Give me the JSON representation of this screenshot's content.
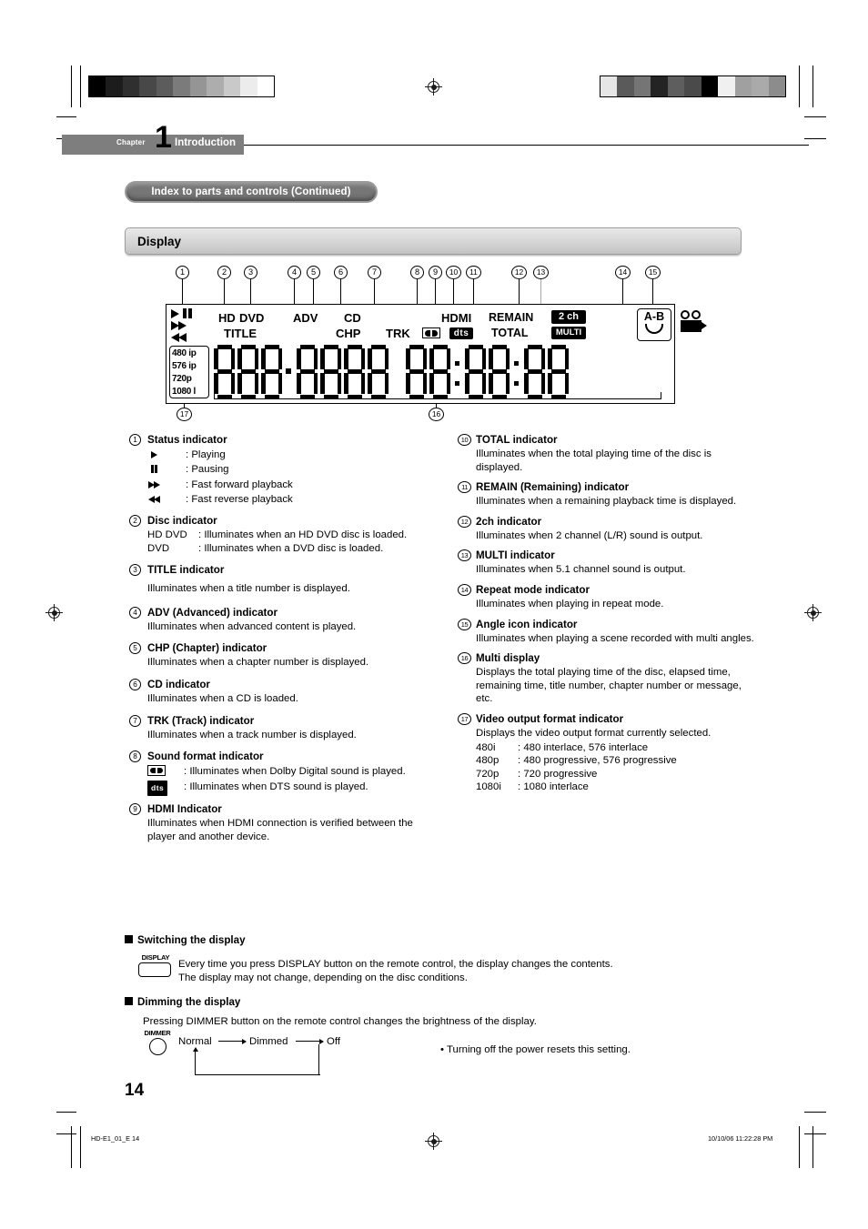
{
  "page": {
    "number": "14",
    "chapter_word": "Chapter",
    "chapter_number": "1",
    "chapter_name": "Introduction",
    "pill_title": "Index to parts and controls (Continued)",
    "section_title": "Display"
  },
  "footer": {
    "file": "HD-E1_01_E   14",
    "timestamp": "10/10/06   11:22:28 PM"
  },
  "calbars": {
    "left": [
      "#000000",
      "#1c1c1c",
      "#2f2f2f",
      "#484848",
      "#5c5c5c",
      "#7b7b7b",
      "#959595",
      "#adadad",
      "#c9c9c9",
      "#ececec",
      "#ffffff"
    ],
    "right": [
      "#e6e6e6",
      "#5a5a5a",
      "#757575",
      "#242424",
      "#5e5e5e",
      "#4a4a4a",
      "#000000",
      "#f0f0f0",
      "#a0a0a0",
      "#aaaaaa",
      "#8c8c8c"
    ]
  },
  "lcd": {
    "callouts": [
      "1",
      "2",
      "3",
      "4",
      "5",
      "6",
      "7",
      "8",
      "9",
      "10",
      "11",
      "12",
      "13",
      "14",
      "15",
      "16",
      "17"
    ],
    "labels": {
      "hd": "HD",
      "dvd": "DVD",
      "title": "TITLE",
      "adv": "ADV",
      "cd": "CD",
      "chp": "CHP",
      "trk": "TRK",
      "hdmi": "HDMI",
      "dts": "dts",
      "remain": "REMAIN",
      "total": "TOTAL",
      "two_ch": "2 ch",
      "multi": "MULTI",
      "ab": "A-B"
    },
    "video_formats": [
      "480 ip",
      "576 ip",
      "720p",
      "1080 l"
    ]
  },
  "items_left": [
    {
      "num": "1",
      "head": "Status indicator",
      "defs": [
        {
          "glyph": "play-icon",
          "text": ": Playing"
        },
        {
          "glyph": "pause-icon",
          "text": ": Pausing"
        },
        {
          "glyph": "fast-forward-icon",
          "text": ": Fast forward playback"
        },
        {
          "glyph": "fast-reverse-icon",
          "text": ": Fast reverse playback"
        }
      ]
    },
    {
      "num": "2",
      "head": "Disc indicator",
      "rows": [
        {
          "k": "HD DVD",
          "v": ": Illuminates when an HD DVD disc is loaded."
        },
        {
          "k": "DVD",
          "v": ": Illuminates when a DVD disc is loaded."
        }
      ]
    },
    {
      "num": "3",
      "head": "TITLE indicator",
      "body": "Illuminates when a title number is displayed."
    },
    {
      "num": "4",
      "head": "ADV (Advanced) indicator",
      "body": "Illuminates when advanced content is played."
    },
    {
      "num": "5",
      "head": "CHP (Chapter) indicator",
      "body": "Illuminates when a chapter number is displayed."
    },
    {
      "num": "6",
      "head": "CD indicator",
      "body": "Illuminates when a CD is loaded."
    },
    {
      "num": "7",
      "head": "TRK (Track) indicator",
      "body": "Illuminates when a track number is displayed."
    },
    {
      "num": "8",
      "head": "Sound format indicator",
      "sound_defs": [
        {
          "glyph": "dolby-digital-icon",
          "text": ": Illuminates when Dolby Digital sound is played."
        },
        {
          "glyph": "dts-icon",
          "text": ": Illuminates when DTS sound is played."
        }
      ]
    },
    {
      "num": "9",
      "head": "HDMI Indicator",
      "body": "Illuminates when HDMI connection is verified between the player and another device."
    }
  ],
  "items_right": [
    {
      "num": "10",
      "head": "TOTAL indicator",
      "body": "Illuminates when the total playing time of the disc is displayed."
    },
    {
      "num": "11",
      "head": "REMAIN (Remaining) indicator",
      "body": "Illuminates when a remaining playback time is displayed."
    },
    {
      "num": "12",
      "head": "2ch indicator",
      "body": "Illuminates when 2 channel (L/R) sound is output."
    },
    {
      "num": "13",
      "head": "MULTI indicator",
      "body": "Illuminates when 5.1 channel sound is output."
    },
    {
      "num": "14",
      "head": "Repeat mode indicator",
      "body": "Illuminates when playing in repeat mode."
    },
    {
      "num": "15",
      "head": "Angle icon indicator",
      "body": "Illuminates when playing a scene recorded with multi angles."
    },
    {
      "num": "16",
      "head": "Multi display",
      "body": "Displays the total playing time of the disc, elapsed time, remaining time, title number, chapter number or message, etc."
    },
    {
      "num": "17",
      "head": "Video output format indicator",
      "body": "Displays the video output format currently selected.",
      "formats": [
        {
          "k": "480i",
          "v": ":  480 interlace, 576 interlace"
        },
        {
          "k": "480p",
          "v": ":  480 progressive, 576 progressive"
        },
        {
          "k": "720p",
          "v": ":  720 progressive"
        },
        {
          "k": "1080i",
          "v": ":  1080 interlace"
        }
      ]
    }
  ],
  "switching": {
    "heading": "Switching the display",
    "button_label": "DISPLAY",
    "line1": "Every time you press DISPLAY button on the remote control, the display changes the contents.",
    "line2": "The display may not change, depending on the disc conditions."
  },
  "dimming": {
    "heading": "Dimming the display",
    "intro": "Pressing DIMMER button on the remote control changes the brightness of the display.",
    "button_label": "DIMMER",
    "states": [
      "Normal",
      "Dimmed",
      "Off"
    ],
    "note": "• Turning off the power resets this setting."
  }
}
